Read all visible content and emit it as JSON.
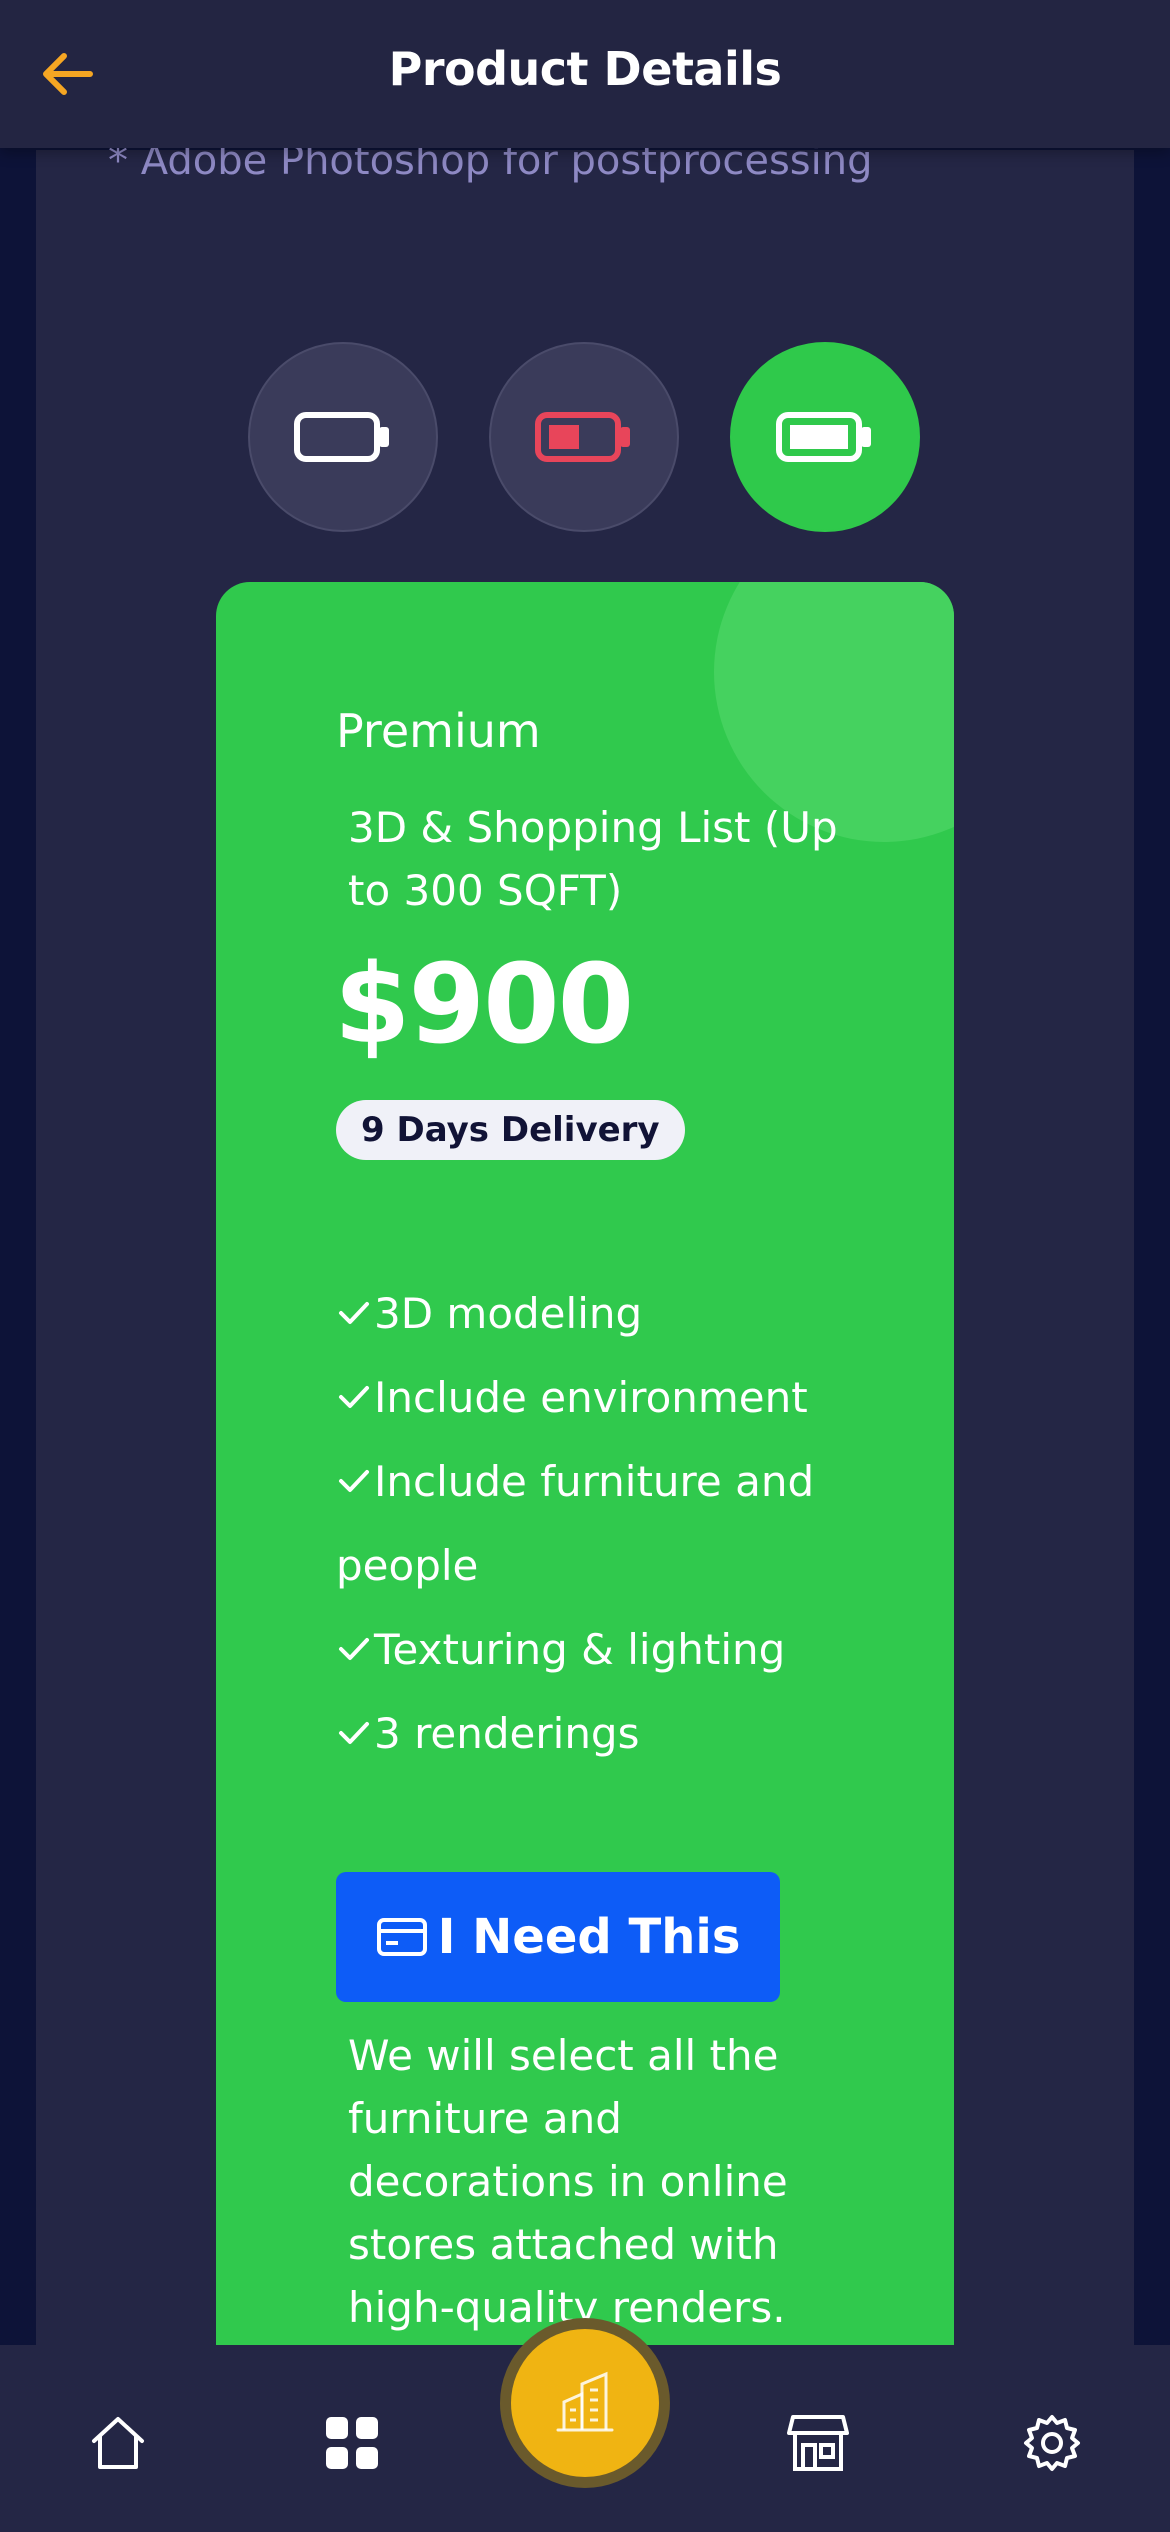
{
  "header": {
    "title": "Product Details",
    "back_icon": "arrow-left-icon",
    "accent_color": "#f5a623"
  },
  "note": "* Adobe Photoshop for postprocessing",
  "tiers": [
    {
      "icon": "battery-empty-icon",
      "state": "inactive"
    },
    {
      "icon": "battery-low-icon",
      "state": "inactive",
      "color": "#e8455a"
    },
    {
      "icon": "battery-full-icon",
      "state": "active"
    }
  ],
  "plan": {
    "name": "Premium",
    "subtitle": "3D & Shopping List (Up to 300 SQFT)",
    "price": "$900",
    "delivery": "9 Days Delivery",
    "features": [
      "3D modeling",
      "Include environment",
      "Include furniture and",
      "people",
      "Texturing & lighting",
      "3 renderings"
    ],
    "cta_label": "I Need This",
    "cta_icon": "credit-card-icon",
    "description": "We will select all the furniture and decorations in online stores attached with high-quality renders.",
    "card_color": "#30c94d",
    "button_color": "#0d5cf7"
  },
  "bottom_nav": {
    "items": [
      {
        "icon": "home-icon"
      },
      {
        "icon": "grid-icon"
      },
      {
        "icon": "building-icon",
        "center": true,
        "color": "#f0b412"
      },
      {
        "icon": "store-icon"
      },
      {
        "icon": "gear-icon"
      }
    ]
  }
}
